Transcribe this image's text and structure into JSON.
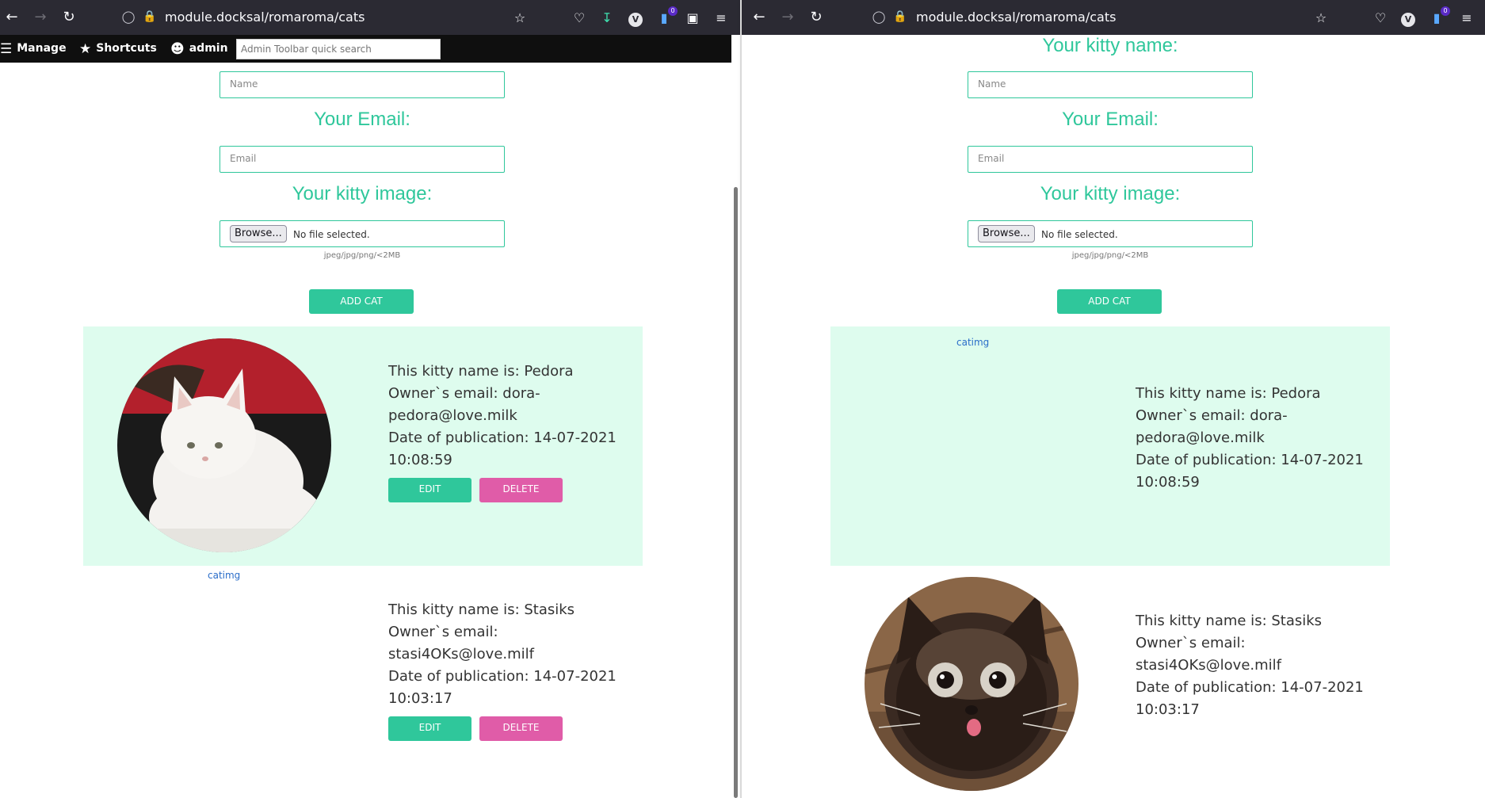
{
  "browser": {
    "url": "module.docksal/romaroma/cats",
    "notification_badge": "0"
  },
  "admin_toolbar": {
    "manage": "Manage",
    "shortcuts": "Shortcuts",
    "user": "admin",
    "search_placeholder": "Admin Toolbar quick search"
  },
  "form": {
    "name_heading": "Your kitty name:",
    "name_placeholder": "Name",
    "email_heading": "Your Email:",
    "email_placeholder": "Email",
    "image_heading": "Your kitty image:",
    "browse_label": "Browse...",
    "file_status": "No file selected.",
    "file_hint": "jpeg/jpg/png/<2MB",
    "submit_label": "ADD CAT"
  },
  "cats": [
    {
      "name_line": "This kitty name is: Pedora",
      "email_line_1": "Owner`s email: dora-",
      "email_line_2": "pedora@love.milk",
      "date_line_1": "Date of publication: 14-07-2021",
      "date_line_2": "10:08:59",
      "image_alt": "catimg",
      "photo_colors": {
        "fur": "#f4f2ef",
        "background_top": "#b3202c",
        "background_bottom": "#1a1a1a"
      }
    },
    {
      "name_line": "This kitty name is: Stasiks",
      "email_line_1": "Owner`s email:",
      "email_line_2": "stasi4OKs@love.milf",
      "date_line_1": "Date of publication: 14-07-2021",
      "date_line_2": "10:03:17",
      "image_alt": "catimg",
      "photo_colors": {
        "fur": "#2a1d17",
        "background": "#8a6647"
      }
    }
  ],
  "actions": {
    "edit_label": "EDIT",
    "delete_label": "DELETE"
  },
  "colors": {
    "accent": "#2fc79b",
    "danger": "#e05ca8",
    "card_background": "#defcee",
    "browser_chrome": "#2b2a33",
    "admin_toolbar": "#0f0f0f"
  }
}
